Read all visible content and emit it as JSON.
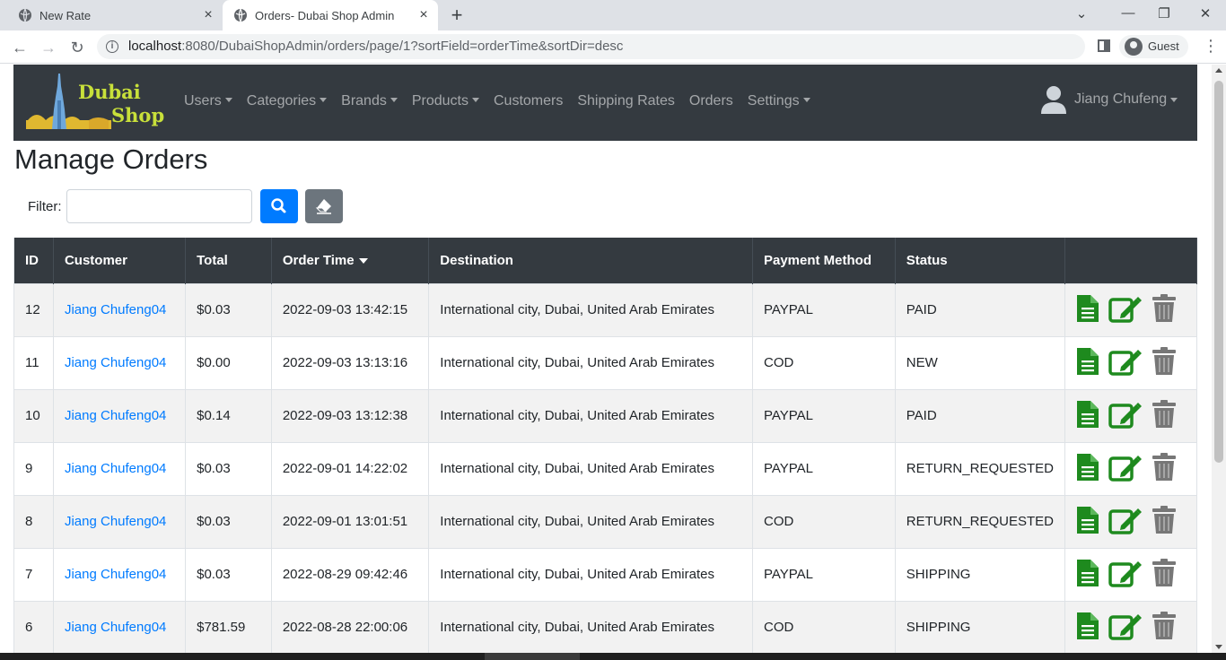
{
  "browser": {
    "tabs": [
      {
        "title": "New Rate"
      },
      {
        "title": "Orders- Dubai Shop Admin"
      }
    ],
    "url_host": "localhost",
    "url_rest": ":8080/DubaiShopAdmin/orders/page/1?sortField=orderTime&sortDir=desc",
    "profile_label": "Guest"
  },
  "navbar": {
    "brand_line1": "Dubai",
    "brand_line2": "Shop",
    "items": [
      {
        "label": "Users",
        "dropdown": true
      },
      {
        "label": "Categories",
        "dropdown": true
      },
      {
        "label": "Brands",
        "dropdown": true
      },
      {
        "label": "Products",
        "dropdown": true
      },
      {
        "label": "Customers",
        "dropdown": false
      },
      {
        "label": "Shipping Rates",
        "dropdown": false
      },
      {
        "label": "Orders",
        "dropdown": false
      },
      {
        "label": "Settings",
        "dropdown": true
      }
    ],
    "user_name": "Jiang Chufeng"
  },
  "page": {
    "title": "Manage Orders",
    "filter_label": "Filter:",
    "filter_value": ""
  },
  "table": {
    "headers": {
      "id": "ID",
      "customer": "Customer",
      "total": "Total",
      "order_time": "Order Time",
      "destination": "Destination",
      "payment_method": "Payment Method",
      "status": "Status"
    },
    "rows": [
      {
        "id": "12",
        "customer": "Jiang Chufeng04",
        "total": "$0.03",
        "order_time": "2022-09-03 13:42:15",
        "destination": "International city, Dubai, United Arab Emirates",
        "payment_method": "PAYPAL",
        "status": "PAID"
      },
      {
        "id": "11",
        "customer": "Jiang Chufeng04",
        "total": "$0.00",
        "order_time": "2022-09-03 13:13:16",
        "destination": "International city, Dubai, United Arab Emirates",
        "payment_method": "COD",
        "status": "NEW"
      },
      {
        "id": "10",
        "customer": "Jiang Chufeng04",
        "total": "$0.14",
        "order_time": "2022-09-03 13:12:38",
        "destination": "International city, Dubai, United Arab Emirates",
        "payment_method": "PAYPAL",
        "status": "PAID"
      },
      {
        "id": "9",
        "customer": "Jiang Chufeng04",
        "total": "$0.03",
        "order_time": "2022-09-01 14:22:02",
        "destination": "International city, Dubai, United Arab Emirates",
        "payment_method": "PAYPAL",
        "status": "RETURN_REQUESTED"
      },
      {
        "id": "8",
        "customer": "Jiang Chufeng04",
        "total": "$0.03",
        "order_time": "2022-09-01 13:01:51",
        "destination": "International city, Dubai, United Arab Emirates",
        "payment_method": "COD",
        "status": "RETURN_REQUESTED"
      },
      {
        "id": "7",
        "customer": "Jiang Chufeng04",
        "total": "$0.03",
        "order_time": "2022-08-29 09:42:46",
        "destination": "International city, Dubai, United Arab Emirates",
        "payment_method": "PAYPAL",
        "status": "SHIPPING"
      },
      {
        "id": "6",
        "customer": "Jiang Chufeng04",
        "total": "$781.59",
        "order_time": "2022-08-28 22:00:06",
        "destination": "International city, Dubai, United Arab Emirates",
        "payment_method": "COD",
        "status": "SHIPPING"
      }
    ],
    "row_actions": [
      "file-icon",
      "edit-icon",
      "trash-icon"
    ]
  },
  "colors": {
    "navbar_bg": "#343a40",
    "brand": "#c8e03a",
    "primary": "#007bff",
    "secondary": "#6c757d",
    "action_green": "#1e8a1e",
    "trash_gray": "#777777"
  }
}
